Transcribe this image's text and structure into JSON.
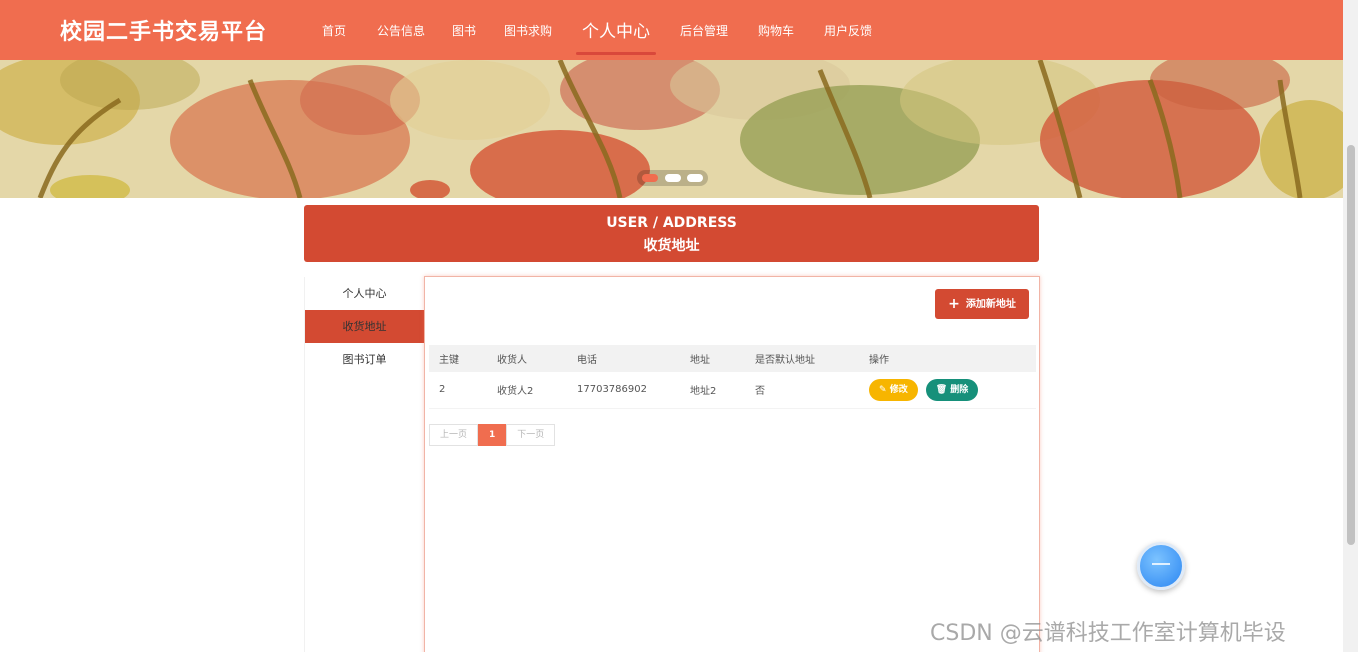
{
  "app": {
    "title": "校园二手书交易平台"
  },
  "nav": {
    "items": [
      {
        "label": "首页"
      },
      {
        "label": "公告信息"
      },
      {
        "label": "图书"
      },
      {
        "label": "图书求购"
      },
      {
        "label": "个人中心"
      },
      {
        "label": "后台管理"
      },
      {
        "label": "购物车"
      },
      {
        "label": "用户反馈"
      }
    ],
    "active": "个人中心"
  },
  "carousel": {
    "slide_count": 3,
    "active_index": 0
  },
  "page_title": {
    "en": "USER / ADDRESS",
    "cn": "收货地址"
  },
  "sidebar": {
    "items": [
      {
        "label": "个人中心"
      },
      {
        "label": "收货地址"
      },
      {
        "label": "图书订单"
      }
    ],
    "active": "收货地址"
  },
  "toolbar": {
    "add_label": "添加新地址"
  },
  "table": {
    "headers": [
      "主键",
      "收货人",
      "电话",
      "地址",
      "是否默认地址",
      "操作"
    ],
    "rows": [
      {
        "id": "2",
        "consignee": "收货人2",
        "phone": "17703786902",
        "address": "地址2",
        "is_default": "否",
        "edit_label": "修改",
        "delete_label": "删除"
      }
    ]
  },
  "pagination": {
    "prev_label": "上一页",
    "current_page": "1",
    "next_label": "下一页"
  },
  "watermark": "CSDN @云谱科技工作室计算机毕设",
  "colors": {
    "primary": "#f06d4f",
    "primary_dark": "#d34a32",
    "edit_button": "#f7b500",
    "delete_button": "#16907a"
  }
}
